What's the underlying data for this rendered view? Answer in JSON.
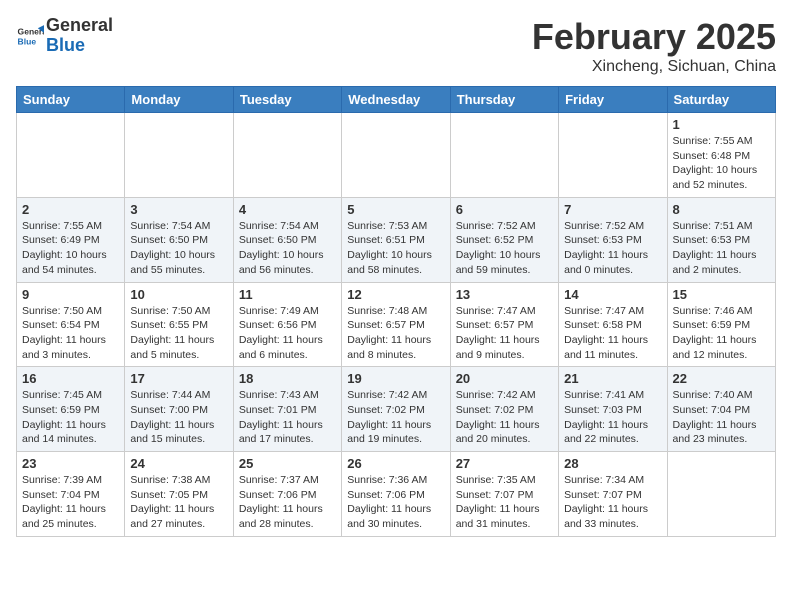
{
  "header": {
    "logo_line1": "General",
    "logo_line2": "Blue",
    "title": "February 2025",
    "subtitle": "Xincheng, Sichuan, China"
  },
  "calendar": {
    "days_of_week": [
      "Sunday",
      "Monday",
      "Tuesday",
      "Wednesday",
      "Thursday",
      "Friday",
      "Saturday"
    ],
    "weeks": [
      [
        {
          "day": "",
          "info": ""
        },
        {
          "day": "",
          "info": ""
        },
        {
          "day": "",
          "info": ""
        },
        {
          "day": "",
          "info": ""
        },
        {
          "day": "",
          "info": ""
        },
        {
          "day": "",
          "info": ""
        },
        {
          "day": "1",
          "info": "Sunrise: 7:55 AM\nSunset: 6:48 PM\nDaylight: 10 hours\nand 52 minutes."
        }
      ],
      [
        {
          "day": "2",
          "info": "Sunrise: 7:55 AM\nSunset: 6:49 PM\nDaylight: 10 hours\nand 54 minutes."
        },
        {
          "day": "3",
          "info": "Sunrise: 7:54 AM\nSunset: 6:50 PM\nDaylight: 10 hours\nand 55 minutes."
        },
        {
          "day": "4",
          "info": "Sunrise: 7:54 AM\nSunset: 6:50 PM\nDaylight: 10 hours\nand 56 minutes."
        },
        {
          "day": "5",
          "info": "Sunrise: 7:53 AM\nSunset: 6:51 PM\nDaylight: 10 hours\nand 58 minutes."
        },
        {
          "day": "6",
          "info": "Sunrise: 7:52 AM\nSunset: 6:52 PM\nDaylight: 10 hours\nand 59 minutes."
        },
        {
          "day": "7",
          "info": "Sunrise: 7:52 AM\nSunset: 6:53 PM\nDaylight: 11 hours\nand 0 minutes."
        },
        {
          "day": "8",
          "info": "Sunrise: 7:51 AM\nSunset: 6:53 PM\nDaylight: 11 hours\nand 2 minutes."
        }
      ],
      [
        {
          "day": "9",
          "info": "Sunrise: 7:50 AM\nSunset: 6:54 PM\nDaylight: 11 hours\nand 3 minutes."
        },
        {
          "day": "10",
          "info": "Sunrise: 7:50 AM\nSunset: 6:55 PM\nDaylight: 11 hours\nand 5 minutes."
        },
        {
          "day": "11",
          "info": "Sunrise: 7:49 AM\nSunset: 6:56 PM\nDaylight: 11 hours\nand 6 minutes."
        },
        {
          "day": "12",
          "info": "Sunrise: 7:48 AM\nSunset: 6:57 PM\nDaylight: 11 hours\nand 8 minutes."
        },
        {
          "day": "13",
          "info": "Sunrise: 7:47 AM\nSunset: 6:57 PM\nDaylight: 11 hours\nand 9 minutes."
        },
        {
          "day": "14",
          "info": "Sunrise: 7:47 AM\nSunset: 6:58 PM\nDaylight: 11 hours\nand 11 minutes."
        },
        {
          "day": "15",
          "info": "Sunrise: 7:46 AM\nSunset: 6:59 PM\nDaylight: 11 hours\nand 12 minutes."
        }
      ],
      [
        {
          "day": "16",
          "info": "Sunrise: 7:45 AM\nSunset: 6:59 PM\nDaylight: 11 hours\nand 14 minutes."
        },
        {
          "day": "17",
          "info": "Sunrise: 7:44 AM\nSunset: 7:00 PM\nDaylight: 11 hours\nand 15 minutes."
        },
        {
          "day": "18",
          "info": "Sunrise: 7:43 AM\nSunset: 7:01 PM\nDaylight: 11 hours\nand 17 minutes."
        },
        {
          "day": "19",
          "info": "Sunrise: 7:42 AM\nSunset: 7:02 PM\nDaylight: 11 hours\nand 19 minutes."
        },
        {
          "day": "20",
          "info": "Sunrise: 7:42 AM\nSunset: 7:02 PM\nDaylight: 11 hours\nand 20 minutes."
        },
        {
          "day": "21",
          "info": "Sunrise: 7:41 AM\nSunset: 7:03 PM\nDaylight: 11 hours\nand 22 minutes."
        },
        {
          "day": "22",
          "info": "Sunrise: 7:40 AM\nSunset: 7:04 PM\nDaylight: 11 hours\nand 23 minutes."
        }
      ],
      [
        {
          "day": "23",
          "info": "Sunrise: 7:39 AM\nSunset: 7:04 PM\nDaylight: 11 hours\nand 25 minutes."
        },
        {
          "day": "24",
          "info": "Sunrise: 7:38 AM\nSunset: 7:05 PM\nDaylight: 11 hours\nand 27 minutes."
        },
        {
          "day": "25",
          "info": "Sunrise: 7:37 AM\nSunset: 7:06 PM\nDaylight: 11 hours\nand 28 minutes."
        },
        {
          "day": "26",
          "info": "Sunrise: 7:36 AM\nSunset: 7:06 PM\nDaylight: 11 hours\nand 30 minutes."
        },
        {
          "day": "27",
          "info": "Sunrise: 7:35 AM\nSunset: 7:07 PM\nDaylight: 11 hours\nand 31 minutes."
        },
        {
          "day": "28",
          "info": "Sunrise: 7:34 AM\nSunset: 7:07 PM\nDaylight: 11 hours\nand 33 minutes."
        },
        {
          "day": "",
          "info": ""
        }
      ]
    ]
  }
}
